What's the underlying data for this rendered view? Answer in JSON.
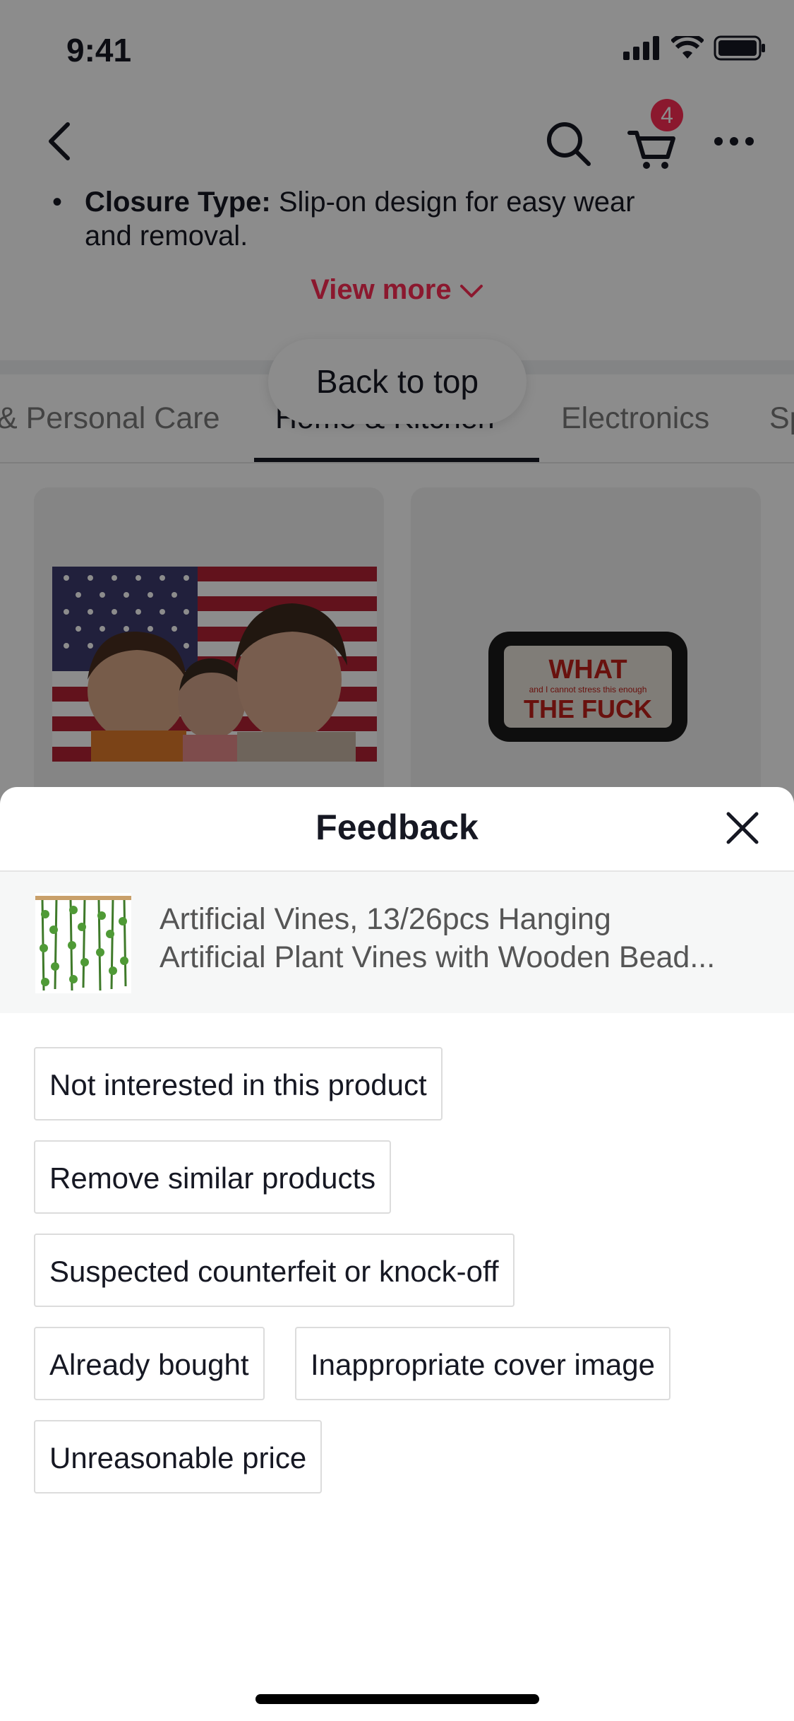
{
  "status_bar": {
    "time": "9:41"
  },
  "header": {
    "cart_count": "4"
  },
  "description": {
    "closure_label": "Closure Type:",
    "closure_text_line1": " Slip-on design for easy wear",
    "closure_text_line2": "and removal.",
    "view_more": "View more"
  },
  "back_to_top": "Back to top",
  "category_tabs": [
    {
      "label": "& Personal Care"
    },
    {
      "label": "Home & Kitchen"
    },
    {
      "label": "Electronics"
    },
    {
      "label": "Sp"
    }
  ],
  "cards": [
    {
      "image": "american-flag-photo"
    },
    {
      "image": "embroidered-pillow",
      "pillow_top": "WHAT",
      "pillow_small": "and I cannot stress this enough",
      "pillow_bottom": "THE FUCK"
    }
  ],
  "feedback": {
    "title": "Feedback",
    "product_title_line1": "Artificial Vines, 13/26pcs Hanging",
    "product_title_line2": "Artificial Plant Vines with Wooden Bead...",
    "reasons": [
      "Not interested in this product",
      "Remove similar products",
      "Suspected counterfeit or knock-off",
      "Already bought",
      "Inappropriate cover image",
      "Unreasonable price"
    ]
  },
  "colors": {
    "accent": "#fe2c55",
    "text": "#161823"
  }
}
